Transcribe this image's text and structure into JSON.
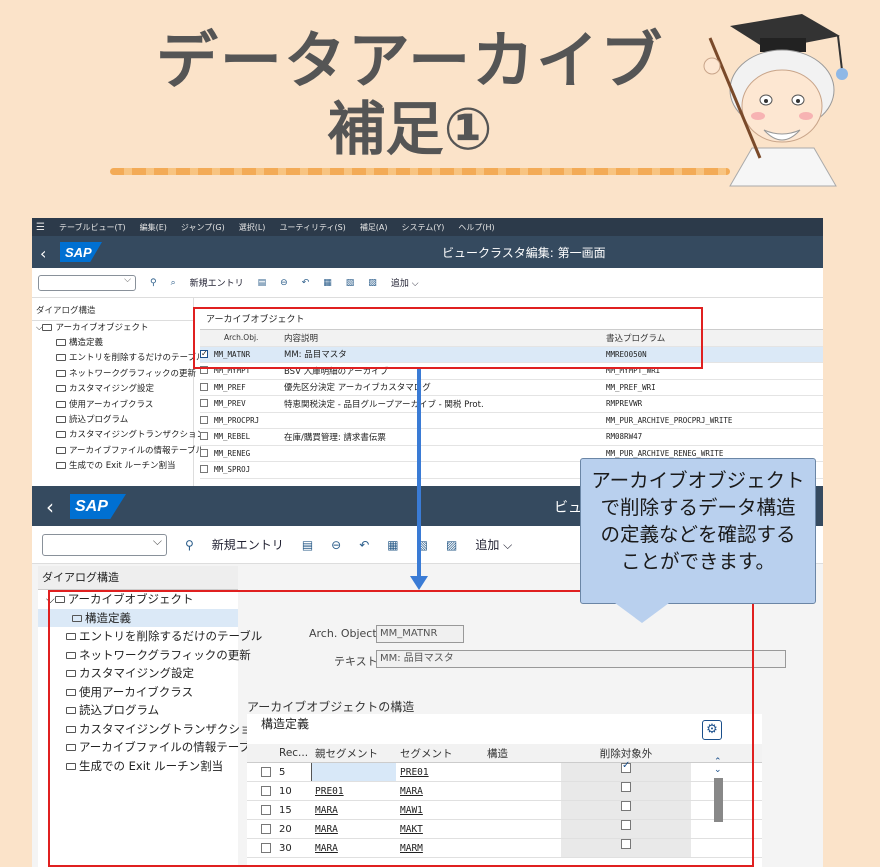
{
  "slide": {
    "title_line1": "データアーカイブ",
    "title_line2": "補足①",
    "callout_text": "アーカイブオブジェクトで削除するデータ構造の定義などを確認することができます。"
  },
  "top_screen": {
    "menu": [
      "テーブルビュー(T)",
      "編集(E)",
      "ジャンプ(G)",
      "選択(L)",
      "ユーティリティ(S)",
      "補足(A)",
      "システム(Y)",
      "ヘルプ(H)"
    ],
    "header_title": "ビュークラスタ編集: 第一画面",
    "toolbar": {
      "new_entry": "新規エントリ",
      "add": "追加"
    },
    "tree_title": "ダイアログ構造",
    "tree_root": "アーカイブオブジェクト",
    "tree_items": [
      "構造定義",
      "エントリを削除するだけのテーブル",
      "ネットワークグラフィックの更新",
      "カスタマイジング設定",
      "使用アーカイブクラス",
      "読込プログラム",
      "カスタマイジングトランザクション",
      "アーカイブファイルの情報テーブル",
      "生成での Exit ルーチン割当"
    ],
    "table_caption": "アーカイブオブジェクト",
    "columns": [
      "Arch.Obj.",
      "内容説明",
      "書込プログラム"
    ],
    "rows": [
      {
        "obj": "MM_MATNR",
        "desc": "MM: 品目マスタ",
        "prog": "MMREO050N",
        "checked": true
      },
      {
        "obj": "MM_MYMPT",
        "desc": "BSV 入庫明細のアーカイブ",
        "prog": "MM_MYMPT_WRI",
        "checked": false
      },
      {
        "obj": "MM_PREF",
        "desc": "優先区分決定 アーカイブカスタマログ",
        "prog": "MM_PREF_WRI",
        "checked": false
      },
      {
        "obj": "MM_PREV",
        "desc": "特恵関税決定 - 品目グループアーカイブ - 関税 Prot.",
        "prog": "RMPREVWR",
        "checked": false
      },
      {
        "obj": "MM_PROCPRJ",
        "desc": "",
        "prog": "MM_PUR_ARCHIVE_PROCPRJ_WRITE",
        "checked": false
      },
      {
        "obj": "MM_REBEL",
        "desc": "在庫/購買管理: 請求書伝票",
        "prog": "RM08RW47",
        "checked": false
      },
      {
        "obj": "MM_RENEG",
        "desc": "",
        "prog": "MM_PUR_ARCHIVE_RENEG_WRITE",
        "checked": false
      },
      {
        "obj": "MM_SPROJ",
        "desc": "",
        "prog": "",
        "checked": false
      }
    ]
  },
  "bottom_screen": {
    "header_title_partial": "ビュ",
    "toolbar": {
      "new_entry": "新規エントリ",
      "add": "追加"
    },
    "tree_title": "ダイアログ構造",
    "tree_root": "アーカイブオブジェクト",
    "tree_items": [
      "構造定義",
      "エントリを削除するだけのテーブル",
      "ネットワークグラフィックの更新",
      "カスタマイジング設定",
      "使用アーカイブクラス",
      "読込プログラム",
      "カスタマイジングトランザクション",
      "アーカイブファイルの情報テーブル",
      "生成での Exit ルーチン割当"
    ],
    "arch_object_label": "Arch. Object:",
    "arch_object_value": "MM_MATNR",
    "text_label": "テキスト:",
    "text_value": "MM: 品目マスタ",
    "structure_section": "アーカイブオブジェクトの構造",
    "structure_table_title": "構造定義",
    "columns": [
      "Rec...",
      "親セグメント",
      "セグメント",
      "構造",
      "削除対象外"
    ],
    "rows": [
      {
        "rec": "5",
        "parent": "",
        "segment": "PRE01",
        "structure": "",
        "excluded": true
      },
      {
        "rec": "10",
        "parent": "PRE01",
        "segment": "MARA",
        "structure": "",
        "excluded": false
      },
      {
        "rec": "15",
        "parent": "MARA",
        "segment": "MAW1",
        "structure": "",
        "excluded": false
      },
      {
        "rec": "20",
        "parent": "MARA",
        "segment": "MAKT",
        "structure": "",
        "excluded": false
      },
      {
        "rec": "30",
        "parent": "MARA",
        "segment": "MARM",
        "structure": "",
        "excluded": false
      }
    ]
  },
  "colors": {
    "background": "#fbe3c9",
    "sap_header": "#354a5f",
    "sap_blue": "#0070d2",
    "highlight_red": "#e02020",
    "callout": "#b9d0ee",
    "arrow": "#3a7bd5"
  }
}
